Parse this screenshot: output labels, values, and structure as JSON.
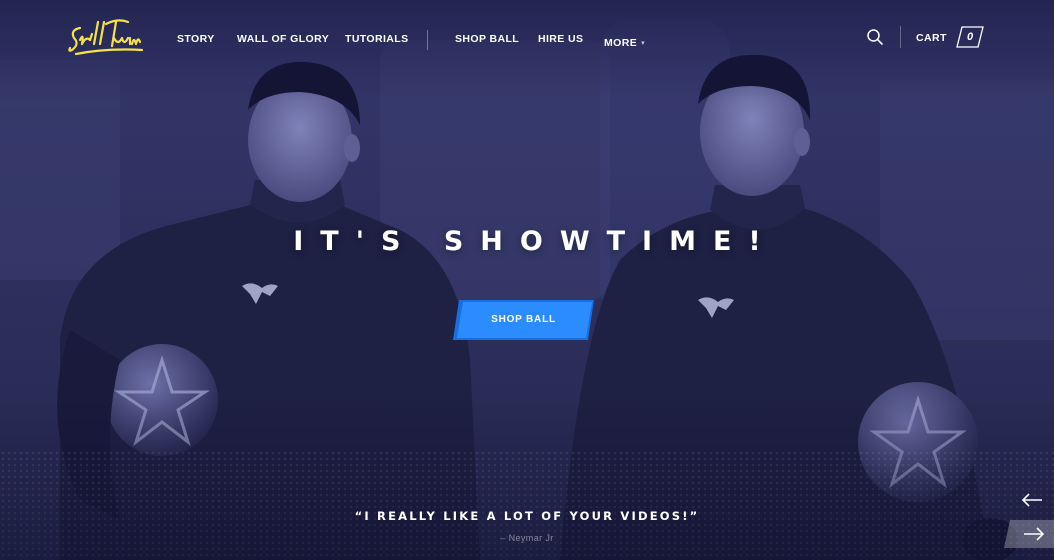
{
  "brand": {
    "logo_alt": "SkillTwins",
    "logo_color": "#f5e24a"
  },
  "nav": {
    "items": [
      {
        "label": "STORY"
      },
      {
        "label": "WALL OF GLORY"
      },
      {
        "label": "TUTORIALS"
      },
      {
        "label": "SHOP BALL"
      },
      {
        "label": "HIRE US"
      }
    ],
    "more_label": "MORE",
    "more_icon": "chevron-down-icon"
  },
  "utility": {
    "search_icon": "search-icon",
    "cart_label": "CART",
    "cart_count": "0"
  },
  "hero": {
    "headline": "IT'S SHOWTIME!",
    "cta_label": "SHOP BALL",
    "cta_color": "#1e88ff",
    "overlay_color": "#2b2d5e"
  },
  "testimonial": {
    "quote": "“I REALLY LIKE A LOT OF YOUR VIDEOS!”",
    "author": "– Neymar Jr"
  },
  "slider": {
    "prev_icon": "arrow-left-icon",
    "next_icon": "arrow-right-icon"
  }
}
